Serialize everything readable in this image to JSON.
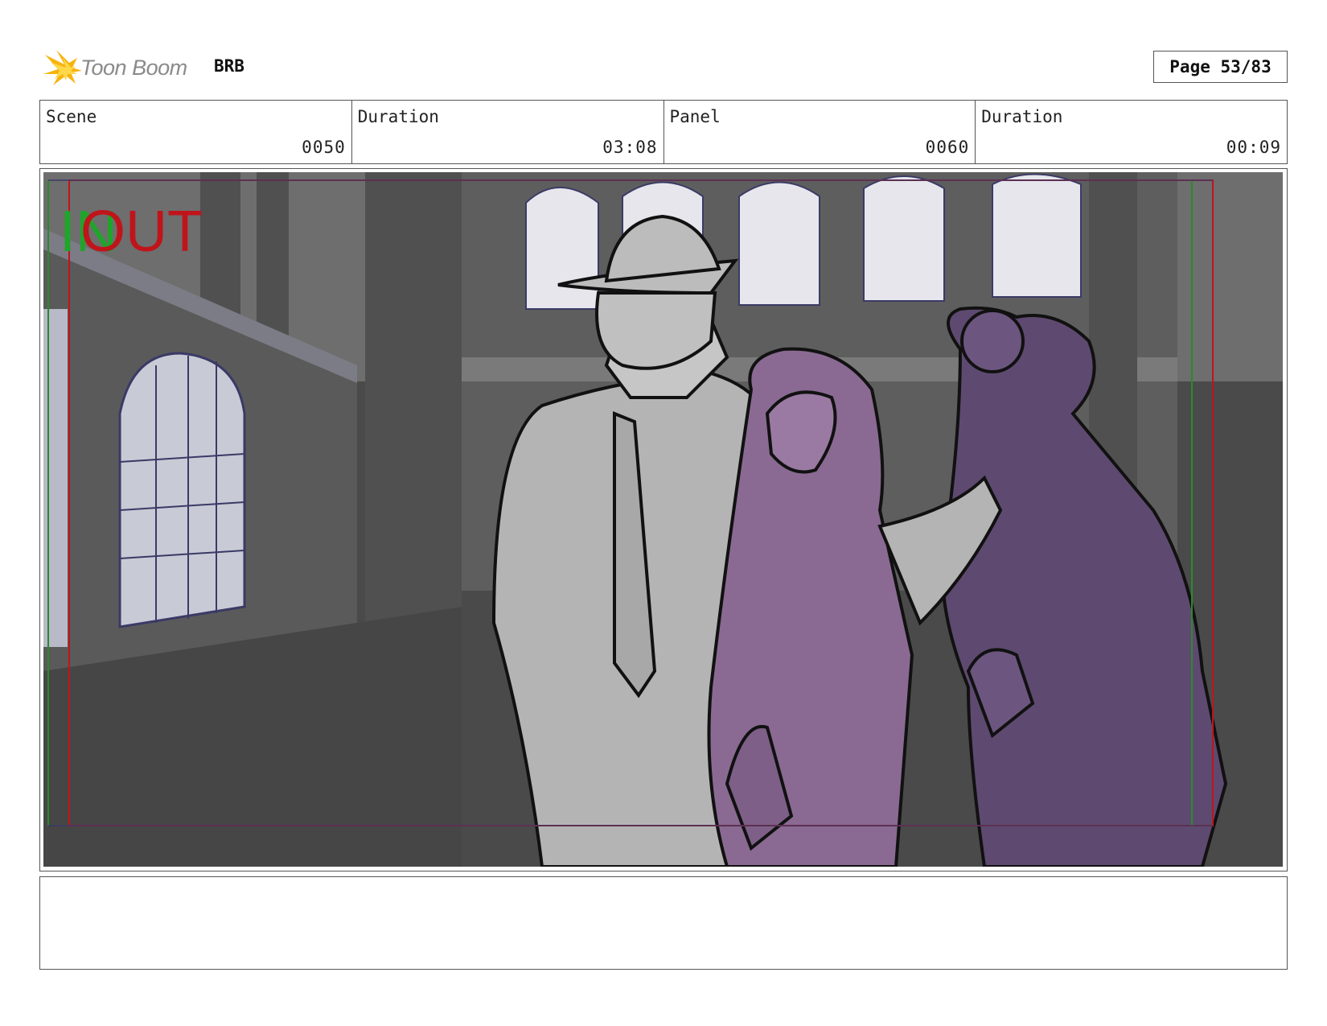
{
  "header": {
    "logo_text": "Toon Boom",
    "project": "BRB",
    "page_label": "Page 53/83"
  },
  "info": {
    "scene_label": "Scene",
    "scene_value": "0050",
    "scene_duration_label": "Duration",
    "scene_duration_value": "03:08",
    "panel_label": "Panel",
    "panel_value": "0060",
    "panel_duration_label": "Duration",
    "panel_duration_value": "00:09"
  },
  "frame": {
    "in_marker": "IN",
    "out_marker": "OUT",
    "in_color": "#1fa52a",
    "out_color": "#c0141b",
    "safe_frame_color": "#c0141b",
    "guide_color": "#2a8a2a"
  },
  "notes": {
    "text": ""
  }
}
